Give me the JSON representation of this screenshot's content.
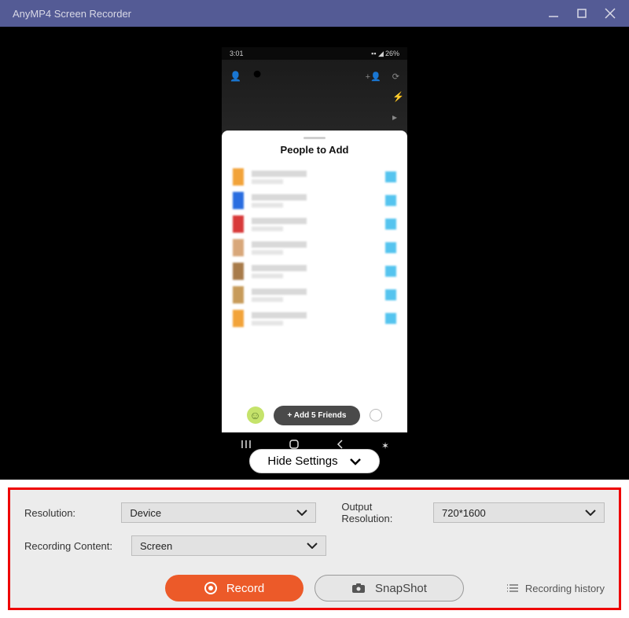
{
  "window": {
    "title": "AnyMP4 Screen Recorder"
  },
  "phone": {
    "time": "3:01",
    "battery": "26%",
    "sheet_title": "People to Add",
    "add_friends_label": "+ Add 5 Friends",
    "contacts": [
      {
        "avatar_color": "#f2a33a"
      },
      {
        "avatar_color": "#2a6de0"
      },
      {
        "avatar_color": "#d83a3a"
      },
      {
        "avatar_color": "#d8a77a"
      },
      {
        "avatar_color": "#a87b4a"
      },
      {
        "avatar_color": "#c79b5a"
      },
      {
        "avatar_color": "#f2a33a"
      }
    ]
  },
  "toggle": {
    "hide_settings_label": "Hide Settings"
  },
  "settings": {
    "resolution_label": "Resolution:",
    "resolution_value": "Device",
    "output_resolution_label": "Output Resolution:",
    "output_resolution_value": "720*1600",
    "recording_content_label": "Recording Content:",
    "recording_content_value": "Screen"
  },
  "actions": {
    "record_label": "Record",
    "snapshot_label": "SnapShot",
    "history_label": "Recording history"
  }
}
